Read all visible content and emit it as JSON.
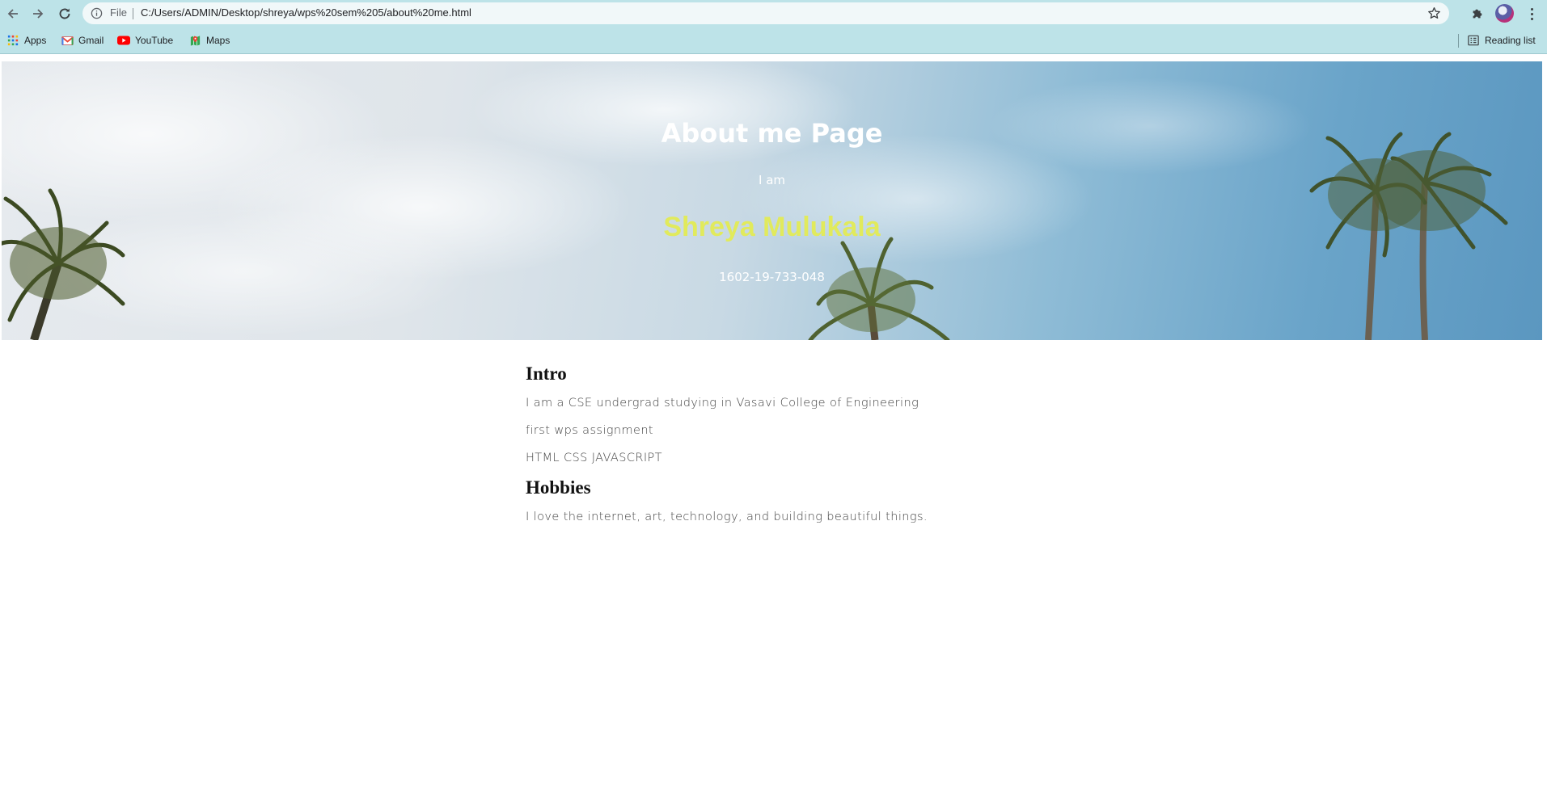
{
  "browser": {
    "file_label": "File",
    "url": "C:/Users/ADMIN/Desktop/shreya/wps%20sem%205/about%20me.html",
    "bookmarks": [
      {
        "label": "Apps",
        "icon": "apps-grid-icon"
      },
      {
        "label": "Gmail",
        "icon": "gmail-icon"
      },
      {
        "label": "YouTube",
        "icon": "youtube-icon"
      },
      {
        "label": "Maps",
        "icon": "maps-icon"
      }
    ],
    "reading_list": "Reading list",
    "chrome_color": "#bde3e8"
  },
  "hero": {
    "title": "About me Page",
    "intro": "I am",
    "name": "Shreya Mulukala",
    "roll_number": "1602-19-733-048",
    "name_color": "#e1ea5c"
  },
  "intro": {
    "heading": "Intro",
    "lines": [
      "I am a CSE undergrad studying in Vasavi College of Engineering",
      "first wps assignment",
      "HTML CSS JAVASCRIPT"
    ]
  },
  "hobbies": {
    "heading": "Hobbies",
    "text": "I love the internet, art, technology, and building beautiful things."
  }
}
